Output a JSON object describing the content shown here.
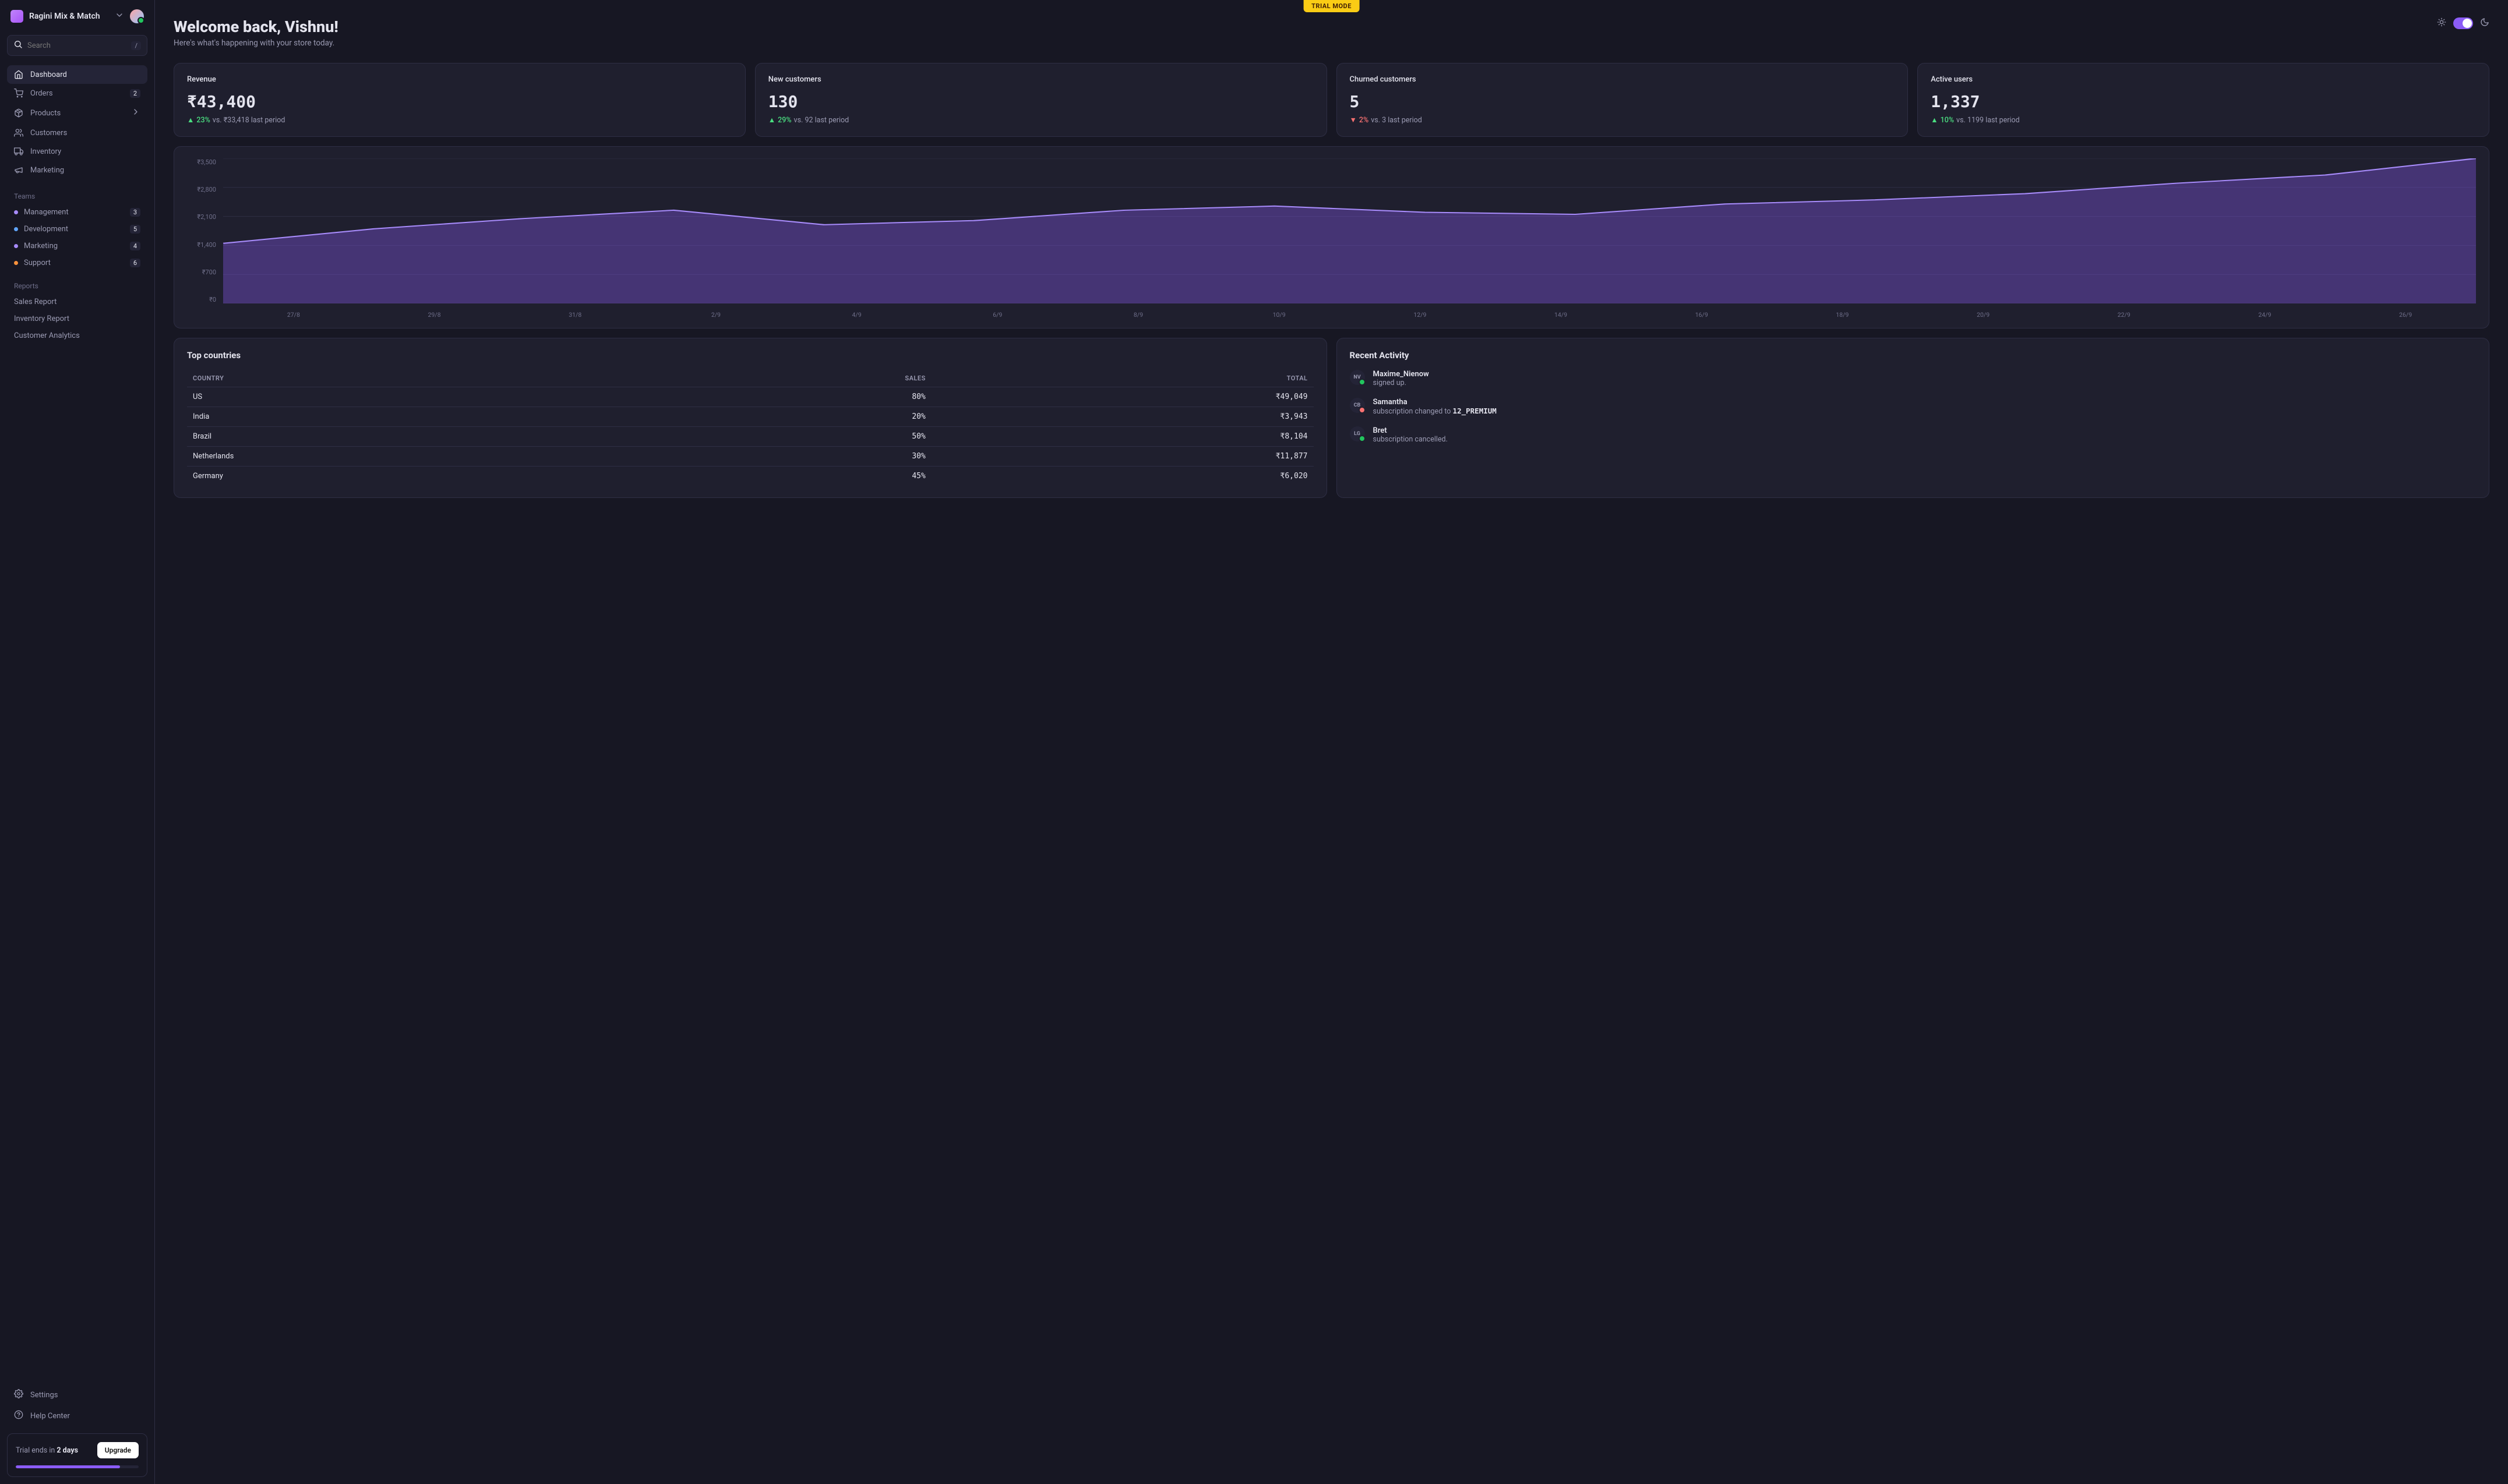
{
  "sidebar": {
    "store_name": "Ragini Mix & Match",
    "search_placeholder": "Search",
    "kbd": "/",
    "nav": [
      {
        "label": "Dashboard",
        "icon": "home",
        "active": true,
        "badge": null
      },
      {
        "label": "Orders",
        "icon": "cart",
        "active": false,
        "badge": "2"
      },
      {
        "label": "Products",
        "icon": "package",
        "active": false,
        "badge": null,
        "chevron": true
      },
      {
        "label": "Customers",
        "icon": "users",
        "active": false,
        "badge": null
      },
      {
        "label": "Inventory",
        "icon": "truck",
        "active": false,
        "badge": null
      },
      {
        "label": "Marketing",
        "icon": "megaphone",
        "active": false,
        "badge": null
      }
    ],
    "teams_title": "Teams",
    "teams": [
      {
        "label": "Management",
        "color": "#a78bfa",
        "count": "3"
      },
      {
        "label": "Development",
        "color": "#60a5fa",
        "count": "5"
      },
      {
        "label": "Marketing",
        "color": "#a78bfa",
        "count": "4"
      },
      {
        "label": "Support",
        "color": "#fb923c",
        "count": "6"
      }
    ],
    "reports_title": "Reports",
    "reports": [
      {
        "label": "Sales Report"
      },
      {
        "label": "Inventory Report"
      },
      {
        "label": "Customer Analytics"
      }
    ],
    "footer": {
      "settings": "Settings",
      "help": "Help Center"
    },
    "trial": {
      "prefix": "Trial ends in ",
      "highlight": "2 days",
      "upgrade": "Upgrade"
    }
  },
  "header": {
    "trial_mode": "TRIAL MODE",
    "title": "Welcome back, Vishnu!",
    "subtitle": "Here's what's happening with your store today."
  },
  "stats": [
    {
      "label": "Revenue",
      "value": "₹43,400",
      "pct": "23%",
      "rest": "vs. ₹33,418 last period",
      "dir": "up"
    },
    {
      "label": "New customers",
      "value": "130",
      "pct": "29%",
      "rest": "vs. 92 last period",
      "dir": "up"
    },
    {
      "label": "Churned customers",
      "value": "5",
      "pct": "2%",
      "rest": "vs. 3 last period",
      "dir": "down"
    },
    {
      "label": "Active users",
      "value": "1,337",
      "pct": "10%",
      "rest": "vs. 1199 last period",
      "dir": "up"
    }
  ],
  "countries": {
    "title": "Top countries",
    "headers": {
      "country": "COUNTRY",
      "sales": "SALES",
      "total": "TOTAL"
    },
    "rows": [
      {
        "country": "US",
        "sales": "80%",
        "total": "₹49,049"
      },
      {
        "country": "India",
        "sales": "20%",
        "total": "₹3,943"
      },
      {
        "country": "Brazil",
        "sales": "50%",
        "total": "₹8,104"
      },
      {
        "country": "Netherlands",
        "sales": "30%",
        "total": "₹11,877"
      },
      {
        "country": "Germany",
        "sales": "45%",
        "total": "₹6,020"
      }
    ]
  },
  "activity": {
    "title": "Recent Activity",
    "items": [
      {
        "initials": "NV",
        "status": "online",
        "name": "Maxime_Nienow",
        "desc_pre": "signed up.",
        "desc_code": "",
        "desc_post": ""
      },
      {
        "initials": "CB",
        "status": "busy",
        "name": "Samantha",
        "desc_pre": "subscription changed to ",
        "desc_code": "12_PREMIUM",
        "desc_post": ""
      },
      {
        "initials": "LG",
        "status": "online",
        "name": "Bret",
        "desc_pre": "subscription cancelled.",
        "desc_code": "",
        "desc_post": ""
      }
    ]
  },
  "chart_data": {
    "type": "area",
    "title": "",
    "xlabel": "",
    "ylabel": "",
    "ylim": [
      0,
      3500
    ],
    "y_ticks": [
      "₹3,500",
      "₹2,800",
      "₹2,100",
      "₹1,400",
      "₹700",
      "₹0"
    ],
    "categories": [
      "27/8",
      "29/8",
      "31/8",
      "2/9",
      "4/9",
      "6/9",
      "8/9",
      "10/9",
      "12/9",
      "14/9",
      "16/9",
      "18/9",
      "20/9",
      "22/9",
      "24/9",
      "26/9"
    ],
    "values": [
      1450,
      1800,
      2050,
      2250,
      1900,
      2000,
      2250,
      2350,
      2200,
      2150,
      2400,
      2500,
      2650,
      2900,
      3100,
      3500
    ]
  }
}
